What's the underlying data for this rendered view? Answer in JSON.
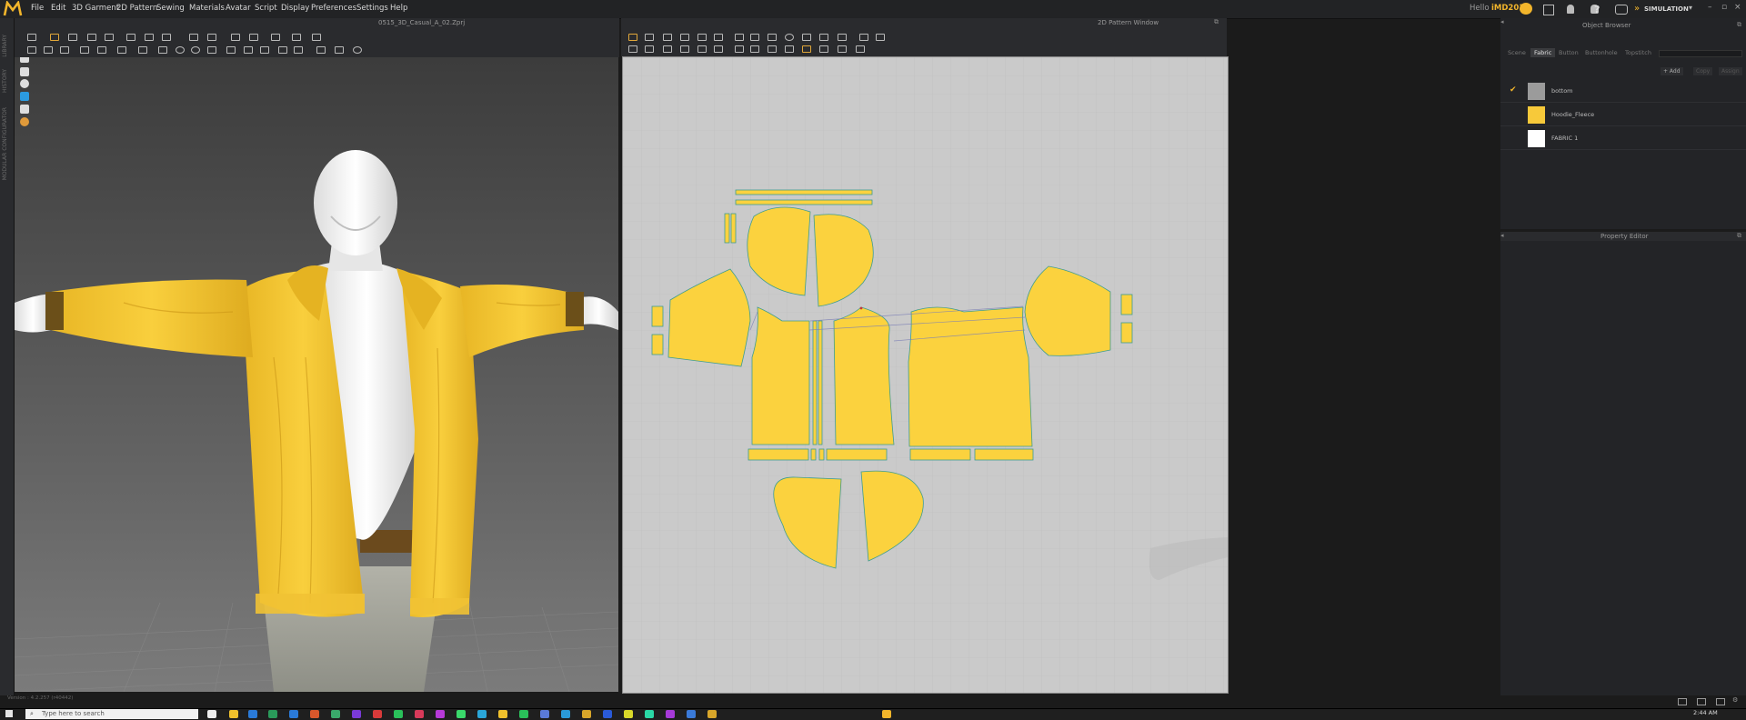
{
  "menu": [
    "File",
    "Edit",
    "3D Garment",
    "2D Pattern",
    "Sewing",
    "Materials",
    "Avatar",
    "Script",
    "Display",
    "Preferences",
    "Settings",
    "Help"
  ],
  "header": {
    "user_greeting": "Hello",
    "user_name": "iMD2018",
    "simulation_label": "SIMULATION"
  },
  "panes": {
    "view3d_title": "0515_3D_Casual_A_02.Zprj",
    "view2d_title": "2D Pattern Window",
    "version": "Version : 4.2.257 (r40442)"
  },
  "left_strip": [
    "LIBRARY",
    "HISTORY",
    "MODULAR CONFIGURATOR"
  ],
  "object_browser": {
    "title": "Object Browser",
    "tabs": [
      "Scene",
      "Fabric",
      "Button",
      "Buttonhole",
      "Topstitch"
    ],
    "active_tab": "Fabric",
    "actions": [
      "+ Add",
      "Copy",
      "Assign"
    ],
    "fabrics": [
      {
        "name": "bottom",
        "color": "#9b9b9b",
        "checked": true
      },
      {
        "name": "Hoodie_Fleece",
        "color": "#f7c93a",
        "checked": false
      },
      {
        "name": "FABRIC 1",
        "color": "#ffffff",
        "checked": false
      }
    ]
  },
  "property_editor": {
    "title": "Property Editor"
  },
  "taskbar": {
    "search_placeholder": "Type here to search",
    "clock_time": "2:44 AM"
  },
  "colors": {
    "fabric_yellow": "#fbd23e",
    "accent": "#e0a73a",
    "pattern_bg": "#cacaca"
  }
}
